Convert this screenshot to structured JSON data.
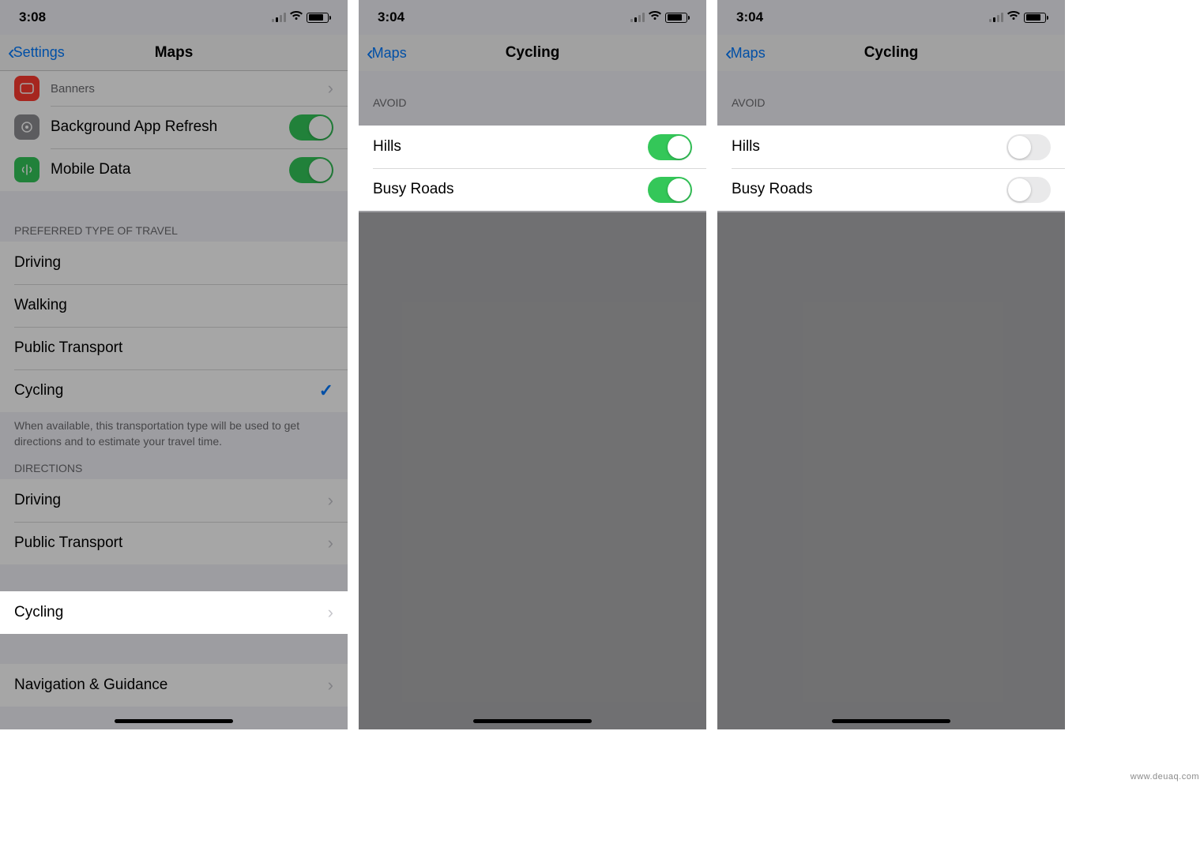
{
  "screens": [
    {
      "status": {
        "time": "3:08"
      },
      "nav": {
        "back": "Settings",
        "title": "Maps"
      },
      "top_rows": {
        "banners": {
          "label": "Banners"
        },
        "bg_refresh": {
          "label": "Background App Refresh",
          "on": true
        },
        "mobile_data": {
          "label": "Mobile Data",
          "on": true
        }
      },
      "preferred_header": "PREFERRED TYPE OF TRAVEL",
      "preferred": {
        "driving": "Driving",
        "walking": "Walking",
        "public_transport": "Public Transport",
        "cycling": "Cycling"
      },
      "preferred_footer": "When available, this transportation type will be used to get directions and to estimate your travel time.",
      "directions_header": "DIRECTIONS",
      "directions": {
        "driving": "Driving",
        "public_transport": "Public Transport",
        "cycling": "Cycling"
      },
      "nav_guidance": "Navigation & Guidance"
    },
    {
      "status": {
        "time": "3:04"
      },
      "nav": {
        "back": "Maps",
        "title": "Cycling"
      },
      "avoid_header": "AVOID",
      "avoid": {
        "hills": {
          "label": "Hills",
          "on": true
        },
        "busy": {
          "label": "Busy Roads",
          "on": true
        }
      }
    },
    {
      "status": {
        "time": "3:04"
      },
      "nav": {
        "back": "Maps",
        "title": "Cycling"
      },
      "avoid_header": "AVOID",
      "avoid": {
        "hills": {
          "label": "Hills",
          "on": false
        },
        "busy": {
          "label": "Busy Roads",
          "on": false
        }
      }
    }
  ],
  "watermark": "www.deuaq.com"
}
